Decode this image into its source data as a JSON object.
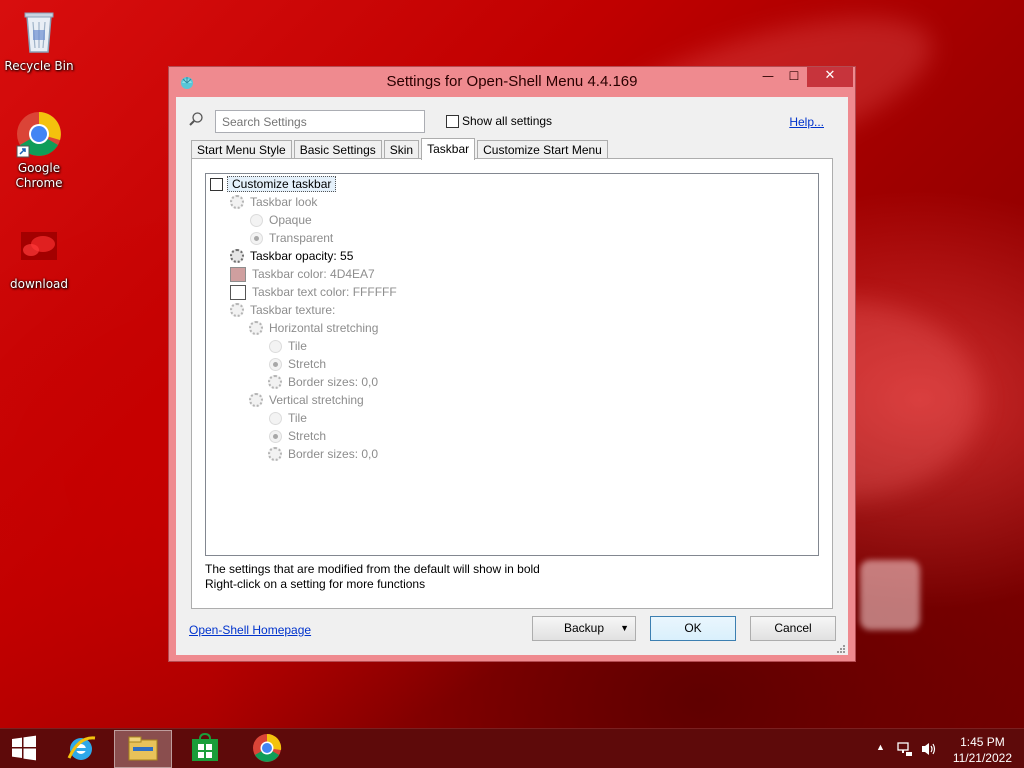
{
  "desktop": {
    "icons": [
      {
        "label": "Recycle Bin"
      },
      {
        "label": "Google Chrome"
      },
      {
        "label": "download"
      }
    ]
  },
  "window": {
    "title": "Settings for Open-Shell Menu 4.4.169",
    "controls": {
      "minimize": "—",
      "maximize": "☐",
      "close": "✕"
    },
    "search": {
      "placeholder": "Search Settings"
    },
    "show_all_label": "Show all settings",
    "help_label": "Help...",
    "tabs": [
      {
        "label": "Start Menu Style",
        "active": false
      },
      {
        "label": "Basic Settings",
        "active": false
      },
      {
        "label": "Skin",
        "active": false
      },
      {
        "label": "Taskbar",
        "active": true
      },
      {
        "label": "Customize Start Menu",
        "active": false
      }
    ],
    "tree": {
      "customize_taskbar": "Customize taskbar",
      "taskbar_look": "Taskbar look",
      "opaque": "Opaque",
      "transparent": "Transparent",
      "taskbar_opacity": "Taskbar opacity: 55",
      "taskbar_color": "Taskbar color: 4D4EA7",
      "taskbar_color_hex": "#cf9f9f",
      "taskbar_text_color": "Taskbar text color: FFFFFF",
      "taskbar_texture": "Taskbar texture:",
      "horizontal_stretching": "Horizontal stretching",
      "h_tile": "Tile",
      "h_stretch": "Stretch",
      "h_border": "Border sizes: 0,0",
      "vertical_stretching": "Vertical stretching",
      "v_tile": "Tile",
      "v_stretch": "Stretch",
      "v_border": "Border sizes: 0,0"
    },
    "note_line1": "The settings that are modified from the default will show in bold",
    "note_line2": "Right-click on a setting for more functions",
    "homepage_link": "Open-Shell Homepage",
    "buttons": {
      "backup": "Backup",
      "ok": "OK",
      "cancel": "Cancel"
    }
  },
  "taskbar": {
    "clock_time": "1:45 PM",
    "clock_date": "11/21/2022",
    "tray_arrow": "▲"
  }
}
